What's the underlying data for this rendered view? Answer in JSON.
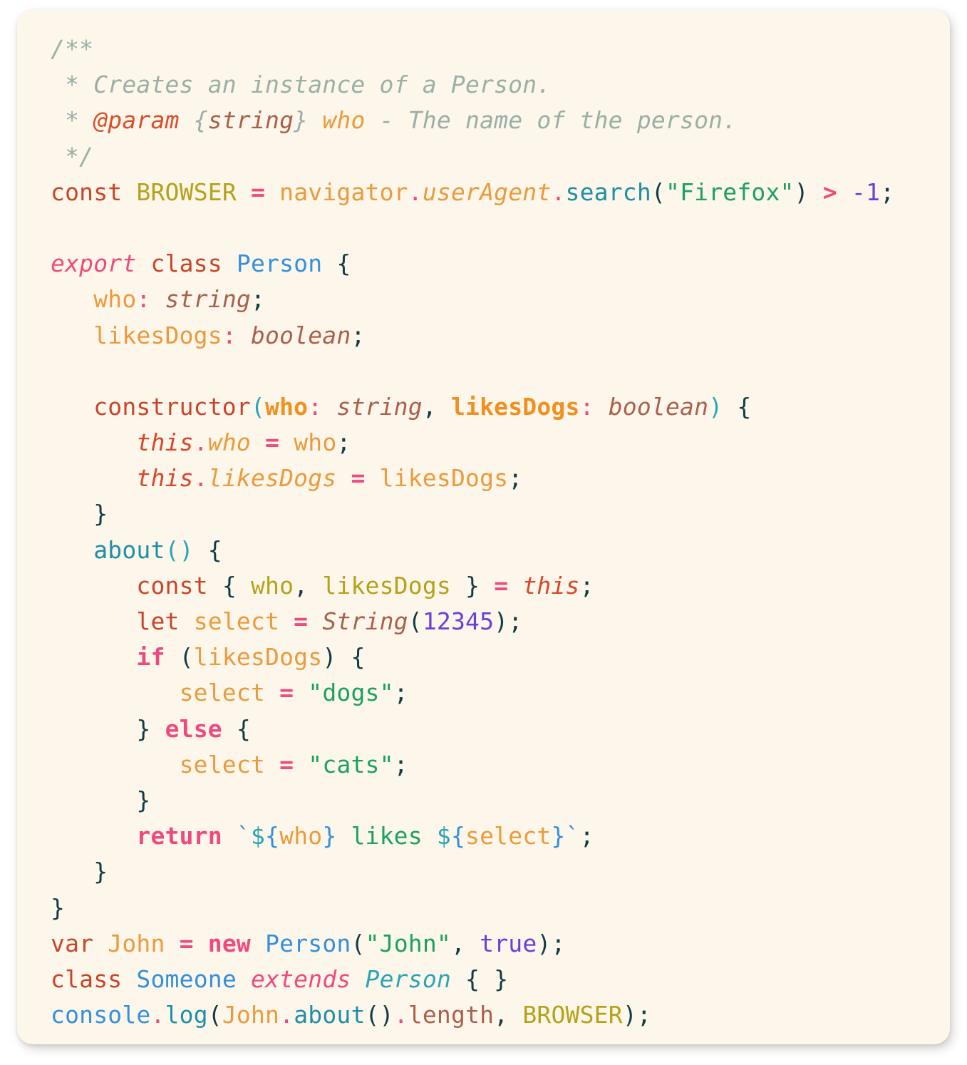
{
  "card": {
    "background": "#fdf6ea",
    "page_background": "#ffffff",
    "corner_radius": "22px"
  },
  "theme": {
    "name": "code-syntax-highlight",
    "colors": {
      "comment": "#9bafa6",
      "doc_tag": "#d94f2b",
      "keyword": "#c7462a",
      "keyword_bold": "#ef4a7f",
      "constant": "#b5a219",
      "operator": "#ef4a7f",
      "variable": "#eb9a3c",
      "function": "#1f8fa8",
      "class": "#3490dc",
      "string": "#1ba25f",
      "number": "#6b3fd9",
      "punctuation": "#103c44",
      "this": "#d9472b",
      "type": "#a9614c",
      "paren": "#2aa5b5",
      "template": "#3490dc"
    }
  },
  "code": {
    "language": "typescript",
    "plain_text": "/**\n * Creates an instance of a Person.\n * @param {string} who - The name of the person.\n */\nconst BROWSER = navigator.userAgent.search(\"Firefox\") > -1;\n\nexport class Person {\n   who: string;\n   likesDogs: boolean;\n\n   constructor(who: string, likesDogs: boolean) {\n      this.who = who;\n      this.likesDogs = likesDogs;\n   }\n   about() {\n      const { who, likesDogs } = this;\n      let select = String(12345);\n      if (likesDogs) {\n         select = \"dogs\";\n      } else {\n         select = \"cats\";\n      }\n      return `${who} likes ${select}`;\n   }\n}\nvar John = new Person(\"John\", true);\nclass Someone extends Person { }\nconsole.log(John.about().length, BROWSER);",
    "lines": [
      {
        "id": "l1",
        "tokens": [
          {
            "t": "/**",
            "c": "t-comment"
          }
        ]
      },
      {
        "id": "l2",
        "tokens": [
          {
            "t": " * Creates an instance of a Person.",
            "c": "t-comment"
          }
        ]
      },
      {
        "id": "l3",
        "tokens": [
          {
            "t": " * ",
            "c": "t-comment"
          },
          {
            "t": "@param",
            "c": "t-tag"
          },
          {
            "t": " ",
            "c": "t-comment"
          },
          {
            "t": "{",
            "c": "t-cbrace"
          },
          {
            "t": "string",
            "c": "t-ctype"
          },
          {
            "t": "}",
            "c": "t-cbrace"
          },
          {
            "t": " ",
            "c": "t-comment"
          },
          {
            "t": "who",
            "c": "t-cparam"
          },
          {
            "t": " - The name of the person.",
            "c": "t-comment"
          }
        ]
      },
      {
        "id": "l4",
        "tokens": [
          {
            "t": " */",
            "c": "t-comment"
          }
        ]
      },
      {
        "id": "l5",
        "tokens": [
          {
            "t": "const",
            "c": "t-kw"
          },
          {
            "t": " ",
            "c": "t-punc"
          },
          {
            "t": "BROWSER",
            "c": "t-const"
          },
          {
            "t": " ",
            "c": "t-punc"
          },
          {
            "t": "=",
            "c": "t-op"
          },
          {
            "t": " ",
            "c": "t-punc"
          },
          {
            "t": "navigator",
            "c": "t-var"
          },
          {
            "t": ".",
            "c": "t-dot"
          },
          {
            "t": "userAgent",
            "c": "t-var-i"
          },
          {
            "t": ".",
            "c": "t-dot"
          },
          {
            "t": "search",
            "c": "t-fn"
          },
          {
            "t": "(",
            "c": "t-punc"
          },
          {
            "t": "\"Firefox\"",
            "c": "t-str"
          },
          {
            "t": ")",
            "c": "t-punc"
          },
          {
            "t": " ",
            "c": "t-punc"
          },
          {
            "t": ">",
            "c": "t-op"
          },
          {
            "t": " ",
            "c": "t-punc"
          },
          {
            "t": "-1",
            "c": "t-num"
          },
          {
            "t": ";",
            "c": "t-punc"
          }
        ]
      },
      {
        "id": "l6",
        "tokens": []
      },
      {
        "id": "l7",
        "tokens": [
          {
            "t": "export",
            "c": "t-kw-i"
          },
          {
            "t": " ",
            "c": "t-punc"
          },
          {
            "t": "class",
            "c": "t-kw"
          },
          {
            "t": " ",
            "c": "t-punc"
          },
          {
            "t": "Person",
            "c": "t-cls"
          },
          {
            "t": " ",
            "c": "t-punc"
          },
          {
            "t": "{",
            "c": "t-punc"
          }
        ]
      },
      {
        "id": "l8",
        "tokens": [
          {
            "t": "   ",
            "c": "t-punc"
          },
          {
            "t": "who",
            "c": "t-var"
          },
          {
            "t": ":",
            "c": "t-dot"
          },
          {
            "t": " ",
            "c": "t-punc"
          },
          {
            "t": "string",
            "c": "t-type"
          },
          {
            "t": ";",
            "c": "t-punc"
          }
        ]
      },
      {
        "id": "l9",
        "tokens": [
          {
            "t": "   ",
            "c": "t-punc"
          },
          {
            "t": "likesDogs",
            "c": "t-var"
          },
          {
            "t": ":",
            "c": "t-dot"
          },
          {
            "t": " ",
            "c": "t-punc"
          },
          {
            "t": "boolean",
            "c": "t-type"
          },
          {
            "t": ";",
            "c": "t-punc"
          }
        ]
      },
      {
        "id": "l10",
        "tokens": []
      },
      {
        "id": "l11",
        "tokens": [
          {
            "t": "   ",
            "c": "t-punc"
          },
          {
            "t": "constructor",
            "c": "t-kw"
          },
          {
            "t": "(",
            "c": "t-paren"
          },
          {
            "t": "who",
            "c": "t-var-b"
          },
          {
            "t": ":",
            "c": "t-dot"
          },
          {
            "t": " ",
            "c": "t-punc"
          },
          {
            "t": "string",
            "c": "t-type"
          },
          {
            "t": ",",
            "c": "t-punc"
          },
          {
            "t": " ",
            "c": "t-punc"
          },
          {
            "t": "likesDogs",
            "c": "t-var-b"
          },
          {
            "t": ":",
            "c": "t-dot"
          },
          {
            "t": " ",
            "c": "t-punc"
          },
          {
            "t": "boolean",
            "c": "t-type"
          },
          {
            "t": ")",
            "c": "t-paren"
          },
          {
            "t": " ",
            "c": "t-punc"
          },
          {
            "t": "{",
            "c": "t-punc"
          }
        ]
      },
      {
        "id": "l12",
        "tokens": [
          {
            "t": "      ",
            "c": "t-punc"
          },
          {
            "t": "this",
            "c": "t-this"
          },
          {
            "t": ".",
            "c": "t-dot"
          },
          {
            "t": "who",
            "c": "t-var-i"
          },
          {
            "t": " ",
            "c": "t-punc"
          },
          {
            "t": "=",
            "c": "t-op"
          },
          {
            "t": " ",
            "c": "t-punc"
          },
          {
            "t": "who",
            "c": "t-var"
          },
          {
            "t": ";",
            "c": "t-punc"
          }
        ]
      },
      {
        "id": "l13",
        "tokens": [
          {
            "t": "      ",
            "c": "t-punc"
          },
          {
            "t": "this",
            "c": "t-this"
          },
          {
            "t": ".",
            "c": "t-dot"
          },
          {
            "t": "likesDogs",
            "c": "t-var-i"
          },
          {
            "t": " ",
            "c": "t-punc"
          },
          {
            "t": "=",
            "c": "t-op"
          },
          {
            "t": " ",
            "c": "t-punc"
          },
          {
            "t": "likesDogs",
            "c": "t-var"
          },
          {
            "t": ";",
            "c": "t-punc"
          }
        ]
      },
      {
        "id": "l14",
        "tokens": [
          {
            "t": "   ",
            "c": "t-punc"
          },
          {
            "t": "}",
            "c": "t-punc"
          }
        ]
      },
      {
        "id": "l15",
        "tokens": [
          {
            "t": "   ",
            "c": "t-punc"
          },
          {
            "t": "about",
            "c": "t-fn"
          },
          {
            "t": "()",
            "c": "t-paren"
          },
          {
            "t": " ",
            "c": "t-punc"
          },
          {
            "t": "{",
            "c": "t-punc"
          }
        ]
      },
      {
        "id": "l16",
        "tokens": [
          {
            "t": "      ",
            "c": "t-punc"
          },
          {
            "t": "const",
            "c": "t-kw"
          },
          {
            "t": " ",
            "c": "t-punc"
          },
          {
            "t": "{",
            "c": "t-punc"
          },
          {
            "t": " ",
            "c": "t-punc"
          },
          {
            "t": "who",
            "c": "t-const"
          },
          {
            "t": ",",
            "c": "t-punc"
          },
          {
            "t": " ",
            "c": "t-punc"
          },
          {
            "t": "likesDogs",
            "c": "t-const"
          },
          {
            "t": " ",
            "c": "t-punc"
          },
          {
            "t": "}",
            "c": "t-punc"
          },
          {
            "t": " ",
            "c": "t-punc"
          },
          {
            "t": "=",
            "c": "t-op"
          },
          {
            "t": " ",
            "c": "t-punc"
          },
          {
            "t": "this",
            "c": "t-this"
          },
          {
            "t": ";",
            "c": "t-punc"
          }
        ]
      },
      {
        "id": "l17",
        "tokens": [
          {
            "t": "      ",
            "c": "t-punc"
          },
          {
            "t": "let",
            "c": "t-kw"
          },
          {
            "t": " ",
            "c": "t-punc"
          },
          {
            "t": "select",
            "c": "t-var"
          },
          {
            "t": " ",
            "c": "t-punc"
          },
          {
            "t": "=",
            "c": "t-op"
          },
          {
            "t": " ",
            "c": "t-punc"
          },
          {
            "t": "String",
            "c": "t-type"
          },
          {
            "t": "(",
            "c": "t-punc"
          },
          {
            "t": "12345",
            "c": "t-num"
          },
          {
            "t": ")",
            "c": "t-punc"
          },
          {
            "t": ";",
            "c": "t-punc"
          }
        ]
      },
      {
        "id": "l18",
        "tokens": [
          {
            "t": "      ",
            "c": "t-punc"
          },
          {
            "t": "if",
            "c": "t-kw-b"
          },
          {
            "t": " ",
            "c": "t-punc"
          },
          {
            "t": "(",
            "c": "t-punc"
          },
          {
            "t": "likesDogs",
            "c": "t-var"
          },
          {
            "t": ")",
            "c": "t-punc"
          },
          {
            "t": " ",
            "c": "t-punc"
          },
          {
            "t": "{",
            "c": "t-punc"
          }
        ]
      },
      {
        "id": "l19",
        "tokens": [
          {
            "t": "         ",
            "c": "t-punc"
          },
          {
            "t": "select",
            "c": "t-var"
          },
          {
            "t": " ",
            "c": "t-punc"
          },
          {
            "t": "=",
            "c": "t-op"
          },
          {
            "t": " ",
            "c": "t-punc"
          },
          {
            "t": "\"dogs\"",
            "c": "t-str"
          },
          {
            "t": ";",
            "c": "t-punc"
          }
        ]
      },
      {
        "id": "l20",
        "tokens": [
          {
            "t": "      ",
            "c": "t-punc"
          },
          {
            "t": "}",
            "c": "t-punc"
          },
          {
            "t": " ",
            "c": "t-punc"
          },
          {
            "t": "else",
            "c": "t-kw-b"
          },
          {
            "t": " ",
            "c": "t-punc"
          },
          {
            "t": "{",
            "c": "t-punc"
          }
        ]
      },
      {
        "id": "l21",
        "tokens": [
          {
            "t": "         ",
            "c": "t-punc"
          },
          {
            "t": "select",
            "c": "t-var"
          },
          {
            "t": " ",
            "c": "t-punc"
          },
          {
            "t": "=",
            "c": "t-op"
          },
          {
            "t": " ",
            "c": "t-punc"
          },
          {
            "t": "\"cats\"",
            "c": "t-str"
          },
          {
            "t": ";",
            "c": "t-punc"
          }
        ]
      },
      {
        "id": "l22",
        "tokens": [
          {
            "t": "      ",
            "c": "t-punc"
          },
          {
            "t": "}",
            "c": "t-punc"
          }
        ]
      },
      {
        "id": "l23",
        "tokens": [
          {
            "t": "      ",
            "c": "t-punc"
          },
          {
            "t": "return",
            "c": "t-kw-b"
          },
          {
            "t": " ",
            "c": "t-punc"
          },
          {
            "t": "`",
            "c": "t-tpl"
          },
          {
            "t": "$",
            "c": "t-paren"
          },
          {
            "t": "{",
            "c": "t-tpl"
          },
          {
            "t": "who",
            "c": "t-var"
          },
          {
            "t": "}",
            "c": "t-tpl"
          },
          {
            "t": " likes ",
            "c": "t-str"
          },
          {
            "t": "$",
            "c": "t-paren"
          },
          {
            "t": "{",
            "c": "t-tpl"
          },
          {
            "t": "select",
            "c": "t-var"
          },
          {
            "t": "}",
            "c": "t-tpl"
          },
          {
            "t": "`",
            "c": "t-tpl"
          },
          {
            "t": ";",
            "c": "t-punc"
          }
        ]
      },
      {
        "id": "l24",
        "tokens": [
          {
            "t": "   ",
            "c": "t-punc"
          },
          {
            "t": "}",
            "c": "t-punc"
          }
        ]
      },
      {
        "id": "l25",
        "tokens": [
          {
            "t": "}",
            "c": "t-punc"
          }
        ]
      },
      {
        "id": "l26",
        "tokens": [
          {
            "t": "var",
            "c": "t-kw"
          },
          {
            "t": " ",
            "c": "t-punc"
          },
          {
            "t": "John",
            "c": "t-var"
          },
          {
            "t": " ",
            "c": "t-punc"
          },
          {
            "t": "=",
            "c": "t-op"
          },
          {
            "t": " ",
            "c": "t-punc"
          },
          {
            "t": "new",
            "c": "t-kw-b"
          },
          {
            "t": " ",
            "c": "t-punc"
          },
          {
            "t": "Person",
            "c": "t-cls"
          },
          {
            "t": "(",
            "c": "t-punc"
          },
          {
            "t": "\"John\"",
            "c": "t-str"
          },
          {
            "t": ",",
            "c": "t-punc"
          },
          {
            "t": " ",
            "c": "t-punc"
          },
          {
            "t": "true",
            "c": "t-num"
          },
          {
            "t": ")",
            "c": "t-punc"
          },
          {
            "t": ";",
            "c": "t-punc"
          }
        ]
      },
      {
        "id": "l27",
        "tokens": [
          {
            "t": "class",
            "c": "t-kw"
          },
          {
            "t": " ",
            "c": "t-punc"
          },
          {
            "t": "Someone",
            "c": "t-cls"
          },
          {
            "t": " ",
            "c": "t-punc"
          },
          {
            "t": "extends",
            "c": "t-kw-i"
          },
          {
            "t": " ",
            "c": "t-punc"
          },
          {
            "t": "Person",
            "c": "t-cls-i"
          },
          {
            "t": " ",
            "c": "t-punc"
          },
          {
            "t": "{ }",
            "c": "t-punc"
          }
        ]
      },
      {
        "id": "l28",
        "tokens": [
          {
            "t": "console",
            "c": "t-obj"
          },
          {
            "t": ".",
            "c": "t-dot"
          },
          {
            "t": "log",
            "c": "t-fn"
          },
          {
            "t": "(",
            "c": "t-punc"
          },
          {
            "t": "John",
            "c": "t-var"
          },
          {
            "t": ".",
            "c": "t-dot"
          },
          {
            "t": "about",
            "c": "t-fn"
          },
          {
            "t": "()",
            "c": "t-punc"
          },
          {
            "t": ".",
            "c": "t-dot"
          },
          {
            "t": "length",
            "c": "t-prop"
          },
          {
            "t": ",",
            "c": "t-punc"
          },
          {
            "t": " ",
            "c": "t-punc"
          },
          {
            "t": "BROWSER",
            "c": "t-const"
          },
          {
            "t": ")",
            "c": "t-punc"
          },
          {
            "t": ";",
            "c": "t-punc"
          }
        ]
      }
    ]
  }
}
